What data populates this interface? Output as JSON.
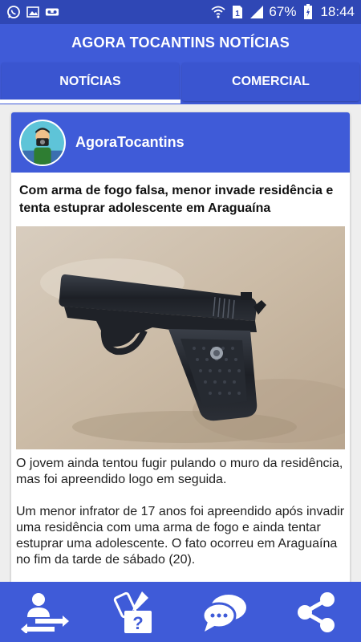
{
  "status_bar": {
    "battery": "67%",
    "time": "18:44",
    "left_icons": [
      "whatsapp-icon",
      "image-icon",
      "voicemail-icon"
    ],
    "right_icons": [
      "wifi-icon",
      "sim-icon",
      "signal-icon",
      "battery-icon"
    ]
  },
  "app": {
    "title": "AGORA TOCANTINS NOTÍCIAS"
  },
  "tabs": [
    {
      "label": "NOTÍCIAS",
      "selected": true
    },
    {
      "label": "COMERCIAL",
      "selected": false
    }
  ],
  "post": {
    "author": "AgoraTocantins",
    "headline": "Com arma de fogo falsa, menor invade residência e tenta estuprar adolescente em Araguaína",
    "paragraphs": [
      "O jovem ainda tentou fugir pulando o muro da residência, mas foi apreendido logo em seguida.",
      "Um menor infrator de 17 anos foi apreendido após invadir uma residência com uma arma de fogo e ainda tentar estuprar uma adolescente. O fato ocorreu em Araguaína no fim da tarde de sábado (20)."
    ]
  },
  "bottom_nav": [
    "transfer-icon",
    "services-icon",
    "chat-icon",
    "share-icon"
  ],
  "colors": {
    "primary": "#3f5bd8",
    "status_bar": "#2f47b5",
    "background": "#eeeeee"
  }
}
